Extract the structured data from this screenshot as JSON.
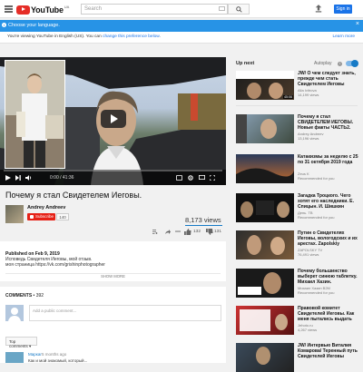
{
  "header": {
    "logo_text": "YouTube",
    "logo_region": "UA",
    "search_placeholder": "Search",
    "signin_label": "Sign in"
  },
  "notice": {
    "title": "Choose your language.",
    "body_prefix": "You're viewing YouTube in English (US). You can ",
    "body_link": "change this preference below",
    "body_suffix": ".",
    "learn_more": "Learn more"
  },
  "player": {
    "time": "0:00 / 41:36",
    "progress": 0.0
  },
  "video": {
    "title": "Почему я стал Свидетелем Иеговы.",
    "channel": "Andrey Andreev",
    "subscribe_label": "Subscribe",
    "subscriber_count": "140",
    "views": "8,173 views",
    "likes": "132",
    "dislikes": "131"
  },
  "description": {
    "published": "Published on Feb 9, 2019",
    "line1": "Исповедь Свидетеля Иеговы, мой отзыв.",
    "line2": "моя страница https://vk.com/grishinphotographer",
    "show_more": "SHOW MORE"
  },
  "comments": {
    "label": "COMMENTS",
    "count": "392",
    "input_placeholder": "Add a public comment...",
    "sort_label": "Top comments",
    "first": {
      "author": "Маркаr",
      "time": "5 months ago",
      "text": "Как и мой знакомый, который..."
    }
  },
  "sidebar": {
    "up_next": "Up next",
    "autoplay": "Autoplay",
    "autoplay_on": true,
    "items": [
      {
        "title": "JW/ О чем следует знать, прежде чем стать Свидетелем Иеговы",
        "channel": "Alla Ivitrova",
        "views": "14,199 views",
        "duration": "45:06"
      },
      {
        "title": "Почему я стал СВИДЕТЕЛЕМ ИЕГОВЫ. Новые факты ЧАСТЬ2.",
        "channel": "Andrey Andreev",
        "views": "13,196 views",
        "duration": ""
      },
      {
        "title": "Катакизмы за неделю с 25 по 31 октября 2019 года",
        "channel": "Zeus K",
        "views": "Recommended for you",
        "duration": ""
      },
      {
        "title": "Загадка Троцкого. Чего хотят его наследники. Е. Спицын. И. Шишкин",
        "channel": "День. ТВ",
        "views": "Recommended for you",
        "duration": ""
      },
      {
        "title": "Путин о Свидетелях Иеговы, вологодских и их арестах. Zapolskiy",
        "channel": "ZAPOLSKY TV",
        "views": "76,491 views",
        "duration": ""
      },
      {
        "title": "Почему большинство выберет синюю таблетку. Михаил Хазин.",
        "channel": "Михаил Хазин B2M",
        "views": "Recommended for you",
        "duration": ""
      },
      {
        "title": "Правовой комитет Свидетелей Иеговы. Как меня пытались выдать",
        "channel": "Jehoto.ru",
        "views": "4,267 views",
        "duration": ""
      },
      {
        "title": "JW/ Интервью Виталия Комарова/ Теренный путь Свидетелей Иеговы",
        "channel": "",
        "views": "",
        "duration": ""
      }
    ]
  },
  "colors": {
    "accent": "#167ac6",
    "brand_red": "#e52d27",
    "notice_blue": "#2793e6"
  }
}
